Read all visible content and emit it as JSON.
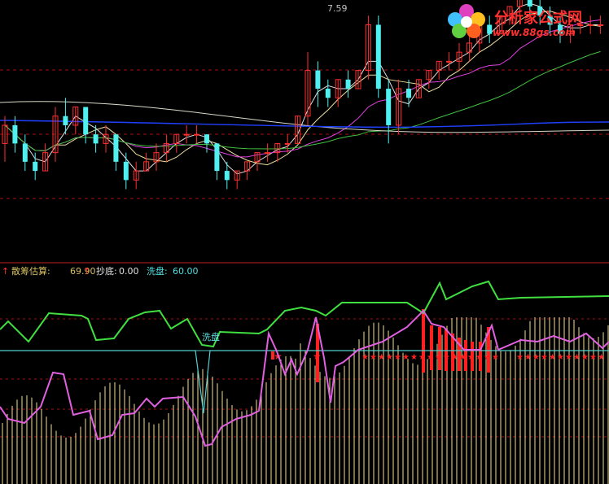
{
  "watermark": {
    "title": "分析家公式网",
    "url": "www.88gs.com"
  },
  "price_chart": {
    "high_label": "7.59"
  },
  "indicator_legend": {
    "arrow": "↑",
    "items": [
      {
        "label": "散筹估算:",
        "value": "69.90"
      },
      {
        "label": "抄底:",
        "value": "0.00"
      },
      {
        "label": "洗盘:",
        "value": "60.00"
      }
    ]
  },
  "indicator_panel": {
    "annotation": "洗盘"
  },
  "colors": {
    "up_candle": "#ff3030",
    "down_candle": "#50f0f0",
    "ma_white": "#e0e0e0",
    "ma_yellow": "#f0e0a0",
    "ma_magenta": "#e040e0",
    "ma_green": "#40c040",
    "ma_blue": "#2040ff",
    "scatter_line": "#e060e0",
    "green_line": "#40e040",
    "xipan_line": "#50d0d0",
    "bars_yellow": "#f0e0a0",
    "signal_red": "#ff2020",
    "grid_red": "#a01010"
  },
  "chart_data": {
    "type": "candlestick+indicator",
    "price_series": {
      "points": [
        [
          6.2,
          6.5,
          6.0,
          6.4
        ],
        [
          6.4,
          6.5,
          6.1,
          6.2
        ],
        [
          6.2,
          6.3,
          5.9,
          6.0
        ],
        [
          6.0,
          6.1,
          5.8,
          5.9
        ],
        [
          5.9,
          6.2,
          5.9,
          6.1
        ],
        [
          6.1,
          6.6,
          6.0,
          6.5
        ],
        [
          6.5,
          6.7,
          6.3,
          6.4
        ],
        [
          6.4,
          6.6,
          6.3,
          6.6
        ],
        [
          6.6,
          6.6,
          6.2,
          6.3
        ],
        [
          6.3,
          6.4,
          6.1,
          6.2
        ],
        [
          6.2,
          6.4,
          6.1,
          6.3
        ],
        [
          6.3,
          6.3,
          5.9,
          6.0
        ],
        [
          6.0,
          6.1,
          5.7,
          5.8
        ],
        [
          5.8,
          6.0,
          5.7,
          5.9
        ],
        [
          5.9,
          6.1,
          5.9,
          6.0
        ],
        [
          6.0,
          6.2,
          5.9,
          6.1
        ],
        [
          6.1,
          6.3,
          6.0,
          6.2
        ],
        [
          6.2,
          6.3,
          6.1,
          6.3
        ],
        [
          6.3,
          6.4,
          6.2,
          6.3
        ],
        [
          6.3,
          6.4,
          6.2,
          6.3
        ],
        [
          6.3,
          6.3,
          6.1,
          6.2
        ],
        [
          6.2,
          6.2,
          5.8,
          5.9
        ],
        [
          5.9,
          6.0,
          5.7,
          5.8
        ],
        [
          5.8,
          5.9,
          5.7,
          5.9
        ],
        [
          5.9,
          6.0,
          5.8,
          6.0
        ],
        [
          6.0,
          6.1,
          5.9,
          6.1
        ],
        [
          6.1,
          6.2,
          6.0,
          6.1
        ],
        [
          6.1,
          6.2,
          6.0,
          6.2
        ],
        [
          6.2,
          6.3,
          6.1,
          6.2
        ],
        [
          6.2,
          6.5,
          6.2,
          6.5
        ],
        [
          6.5,
          7.2,
          6.4,
          7.0
        ],
        [
          7.0,
          7.1,
          6.6,
          6.8
        ],
        [
          6.8,
          6.9,
          6.6,
          6.7
        ],
        [
          6.7,
          6.9,
          6.6,
          6.9
        ],
        [
          6.9,
          7.0,
          6.7,
          6.8
        ],
        [
          6.8,
          7.0,
          6.8,
          7.0
        ],
        [
          7.0,
          7.6,
          6.9,
          7.5
        ],
        [
          7.5,
          7.6,
          6.7,
          6.8
        ],
        [
          6.8,
          6.9,
          6.2,
          6.4
        ],
        [
          6.4,
          6.9,
          6.3,
          6.8
        ],
        [
          6.8,
          6.9,
          6.6,
          6.7
        ],
        [
          6.7,
          6.9,
          6.7,
          6.9
        ],
        [
          6.9,
          7.0,
          6.8,
          7.0
        ],
        [
          7.0,
          7.1,
          6.9,
          7.1
        ],
        [
          7.1,
          7.2,
          7.0,
          7.1
        ],
        [
          7.1,
          7.3,
          7.0,
          7.2
        ],
        [
          7.2,
          7.4,
          7.1,
          7.3
        ],
        [
          7.3,
          7.5,
          7.2,
          7.5
        ],
        [
          7.5,
          7.6,
          7.3,
          7.4
        ],
        [
          7.4,
          7.6,
          7.4,
          7.6
        ],
        [
          7.6,
          7.7,
          7.5,
          7.7
        ],
        [
          7.7,
          7.8,
          7.6,
          7.8
        ],
        [
          7.8,
          7.9,
          7.6,
          7.7
        ],
        [
          7.7,
          7.9,
          7.5,
          7.6
        ],
        [
          7.6,
          7.7,
          7.4,
          7.5
        ],
        [
          7.5,
          7.6,
          7.3,
          7.4
        ],
        [
          7.4,
          7.5,
          7.3,
          7.5
        ],
        [
          7.5,
          7.6,
          7.4,
          7.5
        ],
        [
          7.5,
          7.6,
          7.4,
          7.5
        ],
        [
          7.5,
          7.6,
          7.4,
          7.5
        ]
      ]
    },
    "indicator": {
      "scatter_estimate_last": 69.9,
      "chaodi_last": 0.0,
      "xipan_last": 60.0
    }
  }
}
